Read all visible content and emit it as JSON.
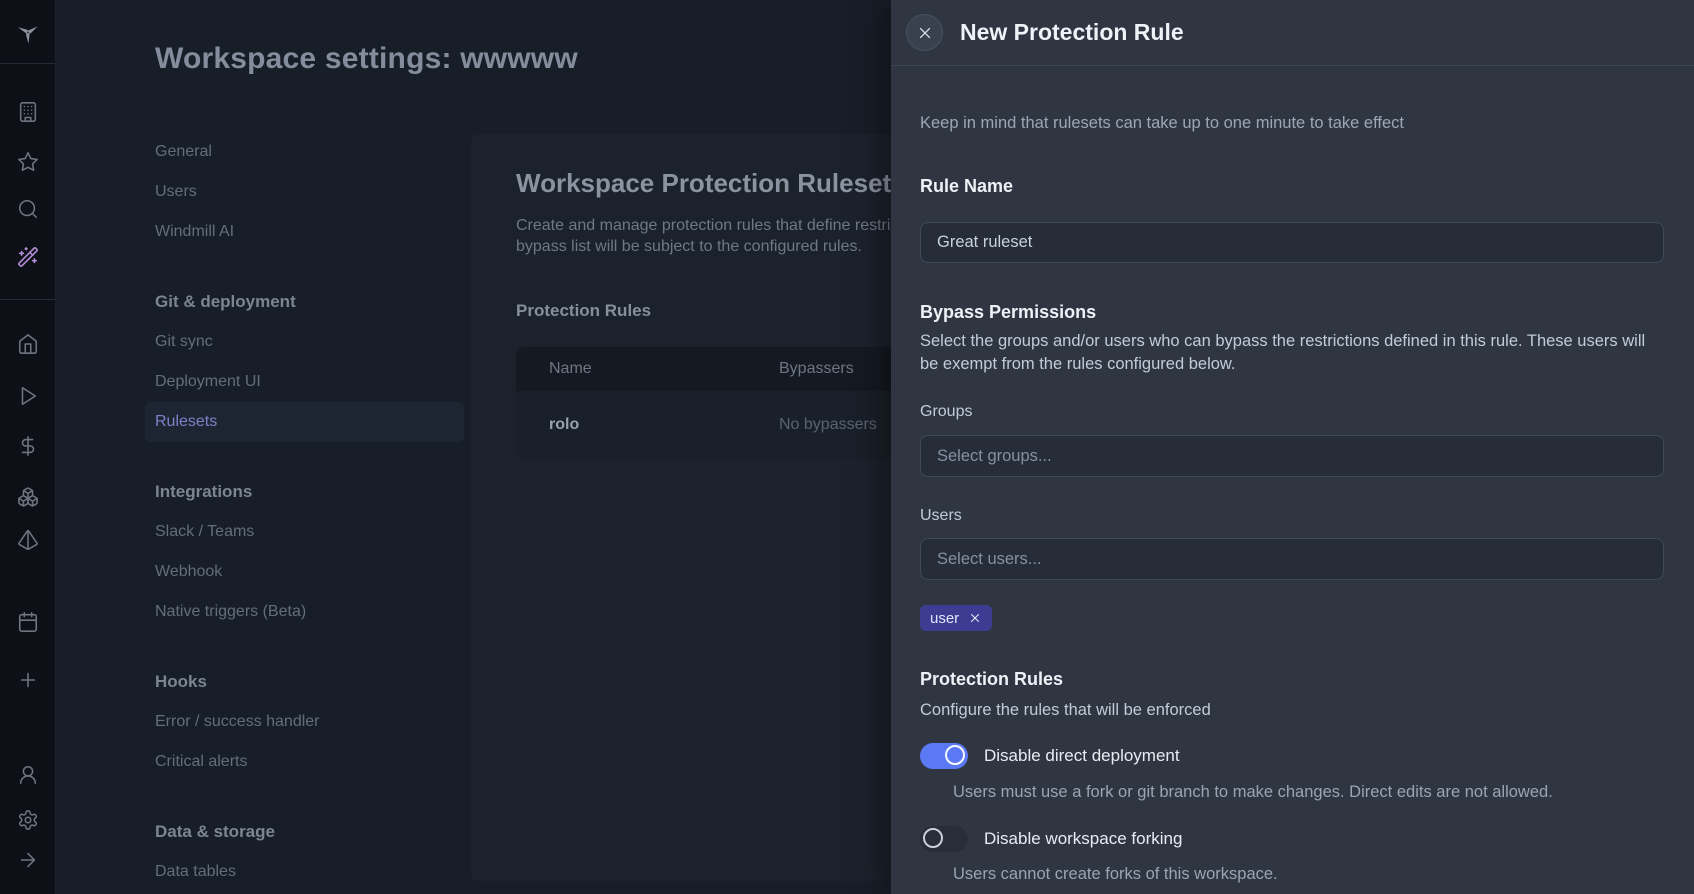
{
  "colors": {
    "rail_bg": "#0d1117",
    "page_bg": "#181e28",
    "card_bg": "#1c222c",
    "drawer_bg": "#2f3642",
    "accent_toggle_on": "#5b79f4",
    "accent_tag": "#3c3d92",
    "selected_nav_text": "#7c82c8"
  },
  "rail": {
    "icons": [
      "windmill-logo",
      "building",
      "star",
      "search",
      "magic-wand",
      "home",
      "play",
      "dollar",
      "boxes",
      "pyramid",
      "calendar",
      "plus",
      "user",
      "gear",
      "arrow-right"
    ]
  },
  "header": {
    "title": "Workspace settings: wwwww"
  },
  "settings_nav": {
    "selected": "Rulesets",
    "groups": [
      {
        "header": "",
        "items": [
          "General",
          "Users",
          "Windmill AI"
        ]
      },
      {
        "header": "Git & deployment",
        "items": [
          "Git sync",
          "Deployment UI",
          "Rulesets"
        ]
      },
      {
        "header": "Integrations",
        "items": [
          "Slack / Teams",
          "Webhook",
          "Native triggers (Beta)"
        ]
      },
      {
        "header": "Hooks",
        "items": [
          "Error / success handler",
          "Critical alerts"
        ]
      },
      {
        "header": "Data & storage",
        "items": [
          "Data tables"
        ]
      }
    ]
  },
  "main_panel": {
    "title": "Workspace Protection Rulesets",
    "description_line1": "Create and manage protection rules that define restrictio",
    "description_line2": "bypass list will be subject to the configured rules.",
    "section_label": "Protection Rules",
    "table": {
      "columns": [
        "Name",
        "Bypassers"
      ],
      "rows": [
        {
          "name": "rolo",
          "bypassers": "No bypassers"
        }
      ]
    }
  },
  "drawer": {
    "title": "New Protection Rule",
    "note": "Keep in mind that rulesets can take up to one minute to take effect",
    "rule_name": {
      "label": "Rule Name",
      "value": "Great ruleset"
    },
    "bypass": {
      "heading": "Bypass Permissions",
      "description": "Select the groups and/or users who can bypass the restrictions defined in this rule. These users will be exempt from the rules configured below.",
      "groups_label": "Groups",
      "groups_placeholder": "Select groups...",
      "users_label": "Users",
      "users_placeholder": "Select users...",
      "selected_user_tag": "user"
    },
    "rules": {
      "heading": "Protection Rules",
      "subheading": "Configure the rules that will be enforced",
      "toggles": [
        {
          "label": "Disable direct deployment",
          "description": "Users must use a fork or git branch to make changes. Direct edits are not allowed.",
          "enabled": true
        },
        {
          "label": "Disable workspace forking",
          "description": "Users cannot create forks of this workspace.",
          "enabled": false
        }
      ]
    }
  }
}
